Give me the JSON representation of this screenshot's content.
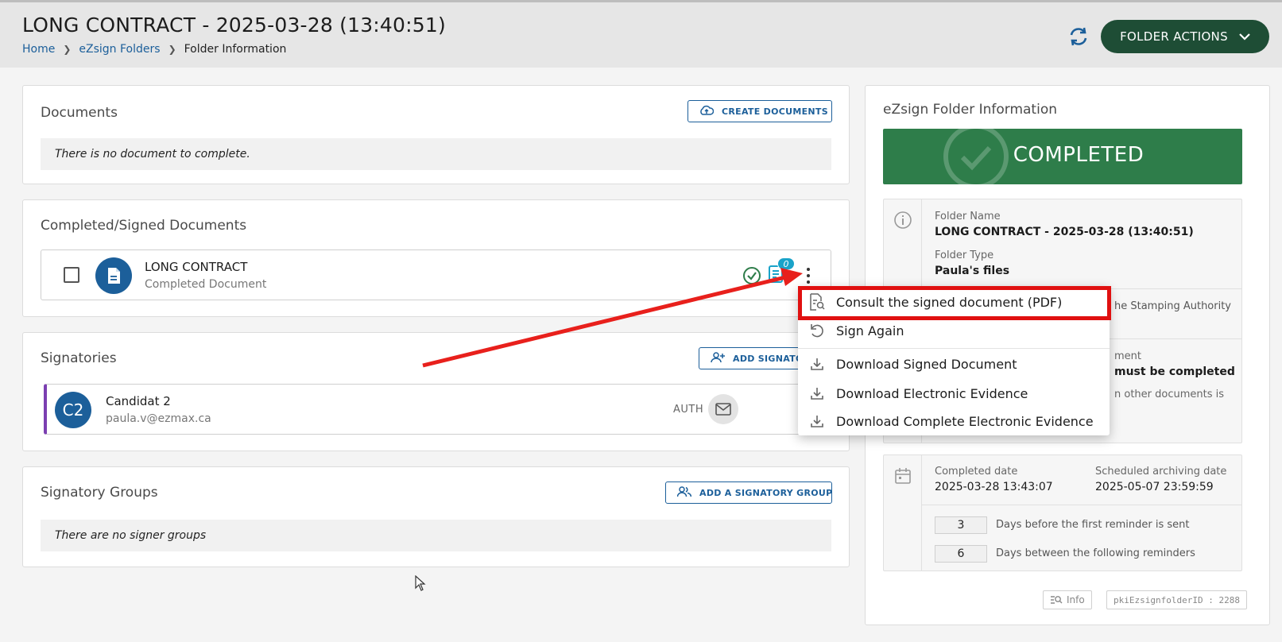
{
  "header": {
    "title": "LONG CONTRACT - 2025-03-28 (13:40:51)",
    "breadcrumb": [
      "Home",
      "eZsign Folders",
      "Folder Information"
    ],
    "folder_actions_label": "FOLDER ACTIONS",
    "colors": {
      "primary": "#1e4d35",
      "link": "#1c5f9a"
    }
  },
  "documents": {
    "title": "Documents",
    "create_label": "CREATE DOCUMENTS",
    "empty_text": "There is no document to complete."
  },
  "completed": {
    "title": "Completed/Signed Documents",
    "doc_name": "LONG CONTRACT",
    "doc_status": "Completed Document",
    "notes_count": "0"
  },
  "signatories": {
    "title": "Signatories",
    "add_label": "ADD SIGNATO",
    "initials": "C2",
    "name": "Candidat 2",
    "email": "paula.v@ezmax.ca",
    "auth": "AUTH",
    "accent": "#7b3fb1"
  },
  "groups": {
    "title": "Signatory Groups",
    "add_label": "ADD A SIGNATORY GROUP",
    "empty_text": "There are no signer groups"
  },
  "folder_info": {
    "title": "eZsign Folder Information",
    "status": "COMPLETED",
    "status_color": "#2e7d4a",
    "folder_name_label": "Folder Name",
    "folder_name": "LONG CONTRACT - 2025-03-28 (13:40:51)",
    "folder_type_label": "Folder Type",
    "folder_type": "Paula's files",
    "partial_stamping": "he Stamping Authority",
    "partial_doc_label": "ment",
    "partial_must": "must be completed",
    "partial_other": "n other documents is",
    "completed_date_label": "Completed date",
    "completed_date": "2025-03-28 13:43:07",
    "archive_label": "Scheduled archiving date",
    "archive_date": "2025-05-07 23:59:59",
    "reminder_first": "3",
    "reminder_first_label": "Days before the first reminder is sent",
    "reminder_next": "6",
    "reminder_next_label": "Days between the following reminders",
    "info_label": "Info",
    "folder_id": "pkiEzsignfolderID : 2288"
  },
  "menu": {
    "items": [
      {
        "label": "Consult the signed document (PDF)",
        "icon": "document-search-icon"
      },
      {
        "label": "Sign Again",
        "icon": "undo-icon"
      },
      {
        "label": "Download Signed Document",
        "icon": "download-icon"
      },
      {
        "label": "Download Electronic Evidence",
        "icon": "download-icon"
      },
      {
        "label": "Download Complete Electronic Evidence",
        "icon": "download-icon"
      }
    ],
    "highlight_color": "#e01010"
  }
}
